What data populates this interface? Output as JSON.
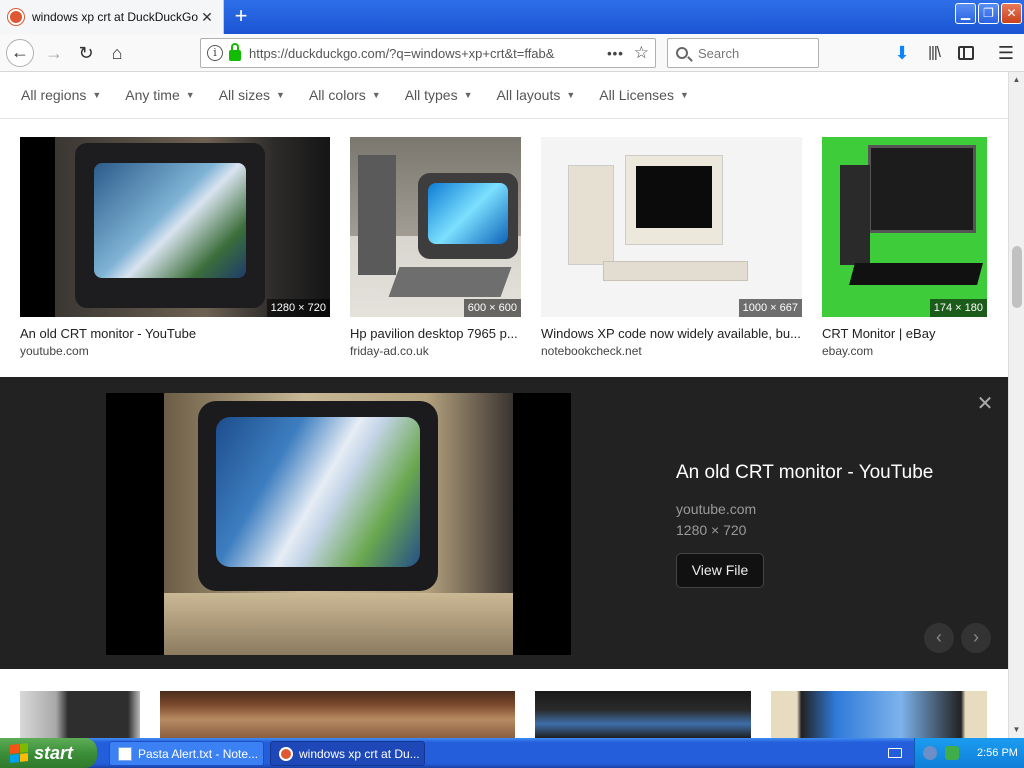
{
  "browser": {
    "tab_title": "windows xp crt at DuckDuckGo",
    "tab_close": "✕",
    "new_tab": "+",
    "url": "https://duckduckgo.com/?q=windows+xp+crt&t=ffab&",
    "search_placeholder": "Search",
    "window_buttons": {
      "minimize": "▁",
      "maximize": "❐",
      "close": "✕"
    }
  },
  "filters": [
    {
      "label": "All regions"
    },
    {
      "label": "Any time"
    },
    {
      "label": "All sizes"
    },
    {
      "label": "All colors"
    },
    {
      "label": "All types"
    },
    {
      "label": "All layouts"
    },
    {
      "label": "All Licenses"
    }
  ],
  "results_row1": [
    {
      "caption": "An old CRT monitor - YouTube",
      "source": "youtube.com",
      "dims": "1280 × 720"
    },
    {
      "caption": "Hp pavilion desktop 7965 p...",
      "source": "friday-ad.co.uk",
      "dims": "600 × 600"
    },
    {
      "caption": "Windows XP code now widely available, bu...",
      "source": "notebookcheck.net",
      "dims": "1000 × 667"
    },
    {
      "caption": "CRT Monitor | eBay",
      "source": "ebay.com",
      "dims": "174 × 180"
    }
  ],
  "preview": {
    "title": "An old CRT monitor - YouTube",
    "domain": "youtube.com",
    "dims": "1280 × 720",
    "view_file": "View File",
    "close": "✕",
    "prev": "‹",
    "next": "›"
  },
  "taskbar": {
    "start": "start",
    "tasks": [
      {
        "label": "Pasta Alert.txt - Note..."
      },
      {
        "label": "windows xp crt at Du..."
      }
    ],
    "clock": "2:56 PM"
  },
  "colors": {
    "accent": "#0a84ff",
    "lock": "#12bc00",
    "xp_blue": "#245edb",
    "start_green": "#3c8f3a",
    "preview_bg": "#222222"
  }
}
